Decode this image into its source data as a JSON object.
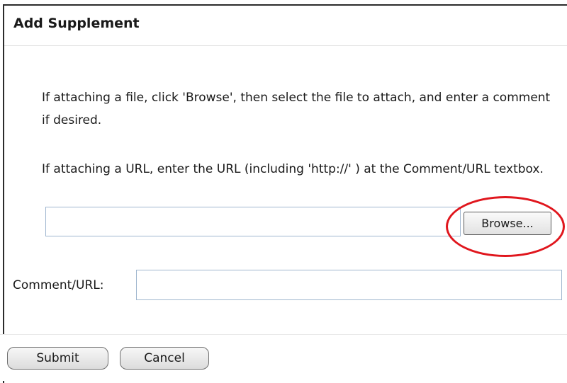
{
  "dialog": {
    "title": "Add Supplement"
  },
  "instructions": {
    "file": "If attaching a file, click 'Browse', then select the file to attach, and enter a comment if desired.",
    "url": "If attaching a URL, enter the URL (including 'http://' ) at the Comment/URL textbox."
  },
  "file_picker": {
    "value": "",
    "browse_label": "Browse..."
  },
  "comment": {
    "label": "Comment/URL:",
    "value": ""
  },
  "actions": {
    "submit_label": "Submit",
    "cancel_label": "Cancel"
  },
  "colors": {
    "highlight": "#e0161d",
    "input_border": "#9fb6cf"
  }
}
